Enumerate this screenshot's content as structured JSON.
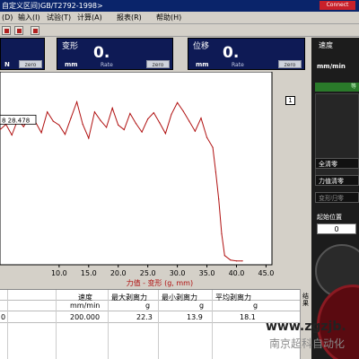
{
  "window": {
    "title": "自定义区间)GB/T2792-1998>",
    "connect": "Connect"
  },
  "menu": {
    "items": [
      "(D)",
      "输入(I)",
      "试验(T)",
      "计算(A)",
      "报表(R)",
      "帮助(H)"
    ]
  },
  "readouts": {
    "force": {
      "unit": "N",
      "zero": "zero"
    },
    "deform": {
      "label": "变形",
      "value": "0.",
      "unit": "mm",
      "rate": "Rate",
      "zero": "zero"
    },
    "displacement": {
      "label": "位移",
      "value": "0.",
      "unit": "mm",
      "rate": "Rate",
      "zero": "zero"
    },
    "speed": {
      "label": "速度",
      "unit": "mm/min"
    }
  },
  "chart_data": {
    "type": "line",
    "xlabel": "力值 - 变形  (g, mm)",
    "ylabel": "",
    "xlim": [
      0,
      46
    ],
    "ylim": [
      0,
      25
    ],
    "xticks": [
      "10.0",
      "15.0",
      "20.0",
      "25.0",
      "30.0",
      "35.0",
      "40.0",
      "45.0"
    ],
    "cursor_label": "28.478",
    "cursor_prefix": "8",
    "marker": "1",
    "series": [
      {
        "x": [
          0,
          1,
          2,
          3,
          4,
          5,
          6,
          7,
          8,
          9,
          10,
          11,
          12,
          13,
          14,
          15,
          16,
          17,
          18,
          19,
          20,
          21,
          22,
          23,
          24,
          25,
          26,
          27,
          28,
          29,
          30,
          31,
          32,
          33,
          34,
          35,
          36,
          36.5,
          37,
          37.5,
          38,
          39,
          40,
          41
        ],
        "y": [
          17.5,
          18.2,
          16.8,
          18.8,
          17.9,
          19.2,
          18.5,
          17.1,
          19.8,
          18.6,
          18.1,
          16.9,
          19.0,
          21.1,
          18.2,
          16.4,
          19.8,
          18.7,
          17.8,
          20.3,
          18.1,
          17.5,
          19.6,
          18.3,
          17.2,
          18.9,
          19.7,
          18.4,
          17.0,
          19.5,
          21.0,
          19.9,
          18.6,
          17.3,
          19.0,
          16.5,
          15.2,
          12.0,
          8.5,
          4.0,
          1.2,
          0.6,
          0.5,
          0.5
        ]
      }
    ]
  },
  "right": {
    "tab_label": "等",
    "buttons": [
      "全清零",
      "力值清零",
      "变形归零"
    ],
    "start_label": "起始位置",
    "start_value": "0"
  },
  "table": {
    "headers": [
      "速度",
      "最大剥离力",
      "最小剥离力",
      "平均剥离力"
    ],
    "units": [
      "mm/min",
      "g",
      "g",
      "g"
    ],
    "row": [
      "200.000",
      "22.3",
      "13.9",
      "18.1"
    ],
    "first_col": "0",
    "side_tab": "结果"
  },
  "watermark": {
    "line1": "www.zgzjb.",
    "line2": "南京超科自动化"
  },
  "colors": {
    "panel_bg": "#0e1a55",
    "title_bg": "#0a246a",
    "curve": "#b01010",
    "connect": "#c8202a"
  }
}
